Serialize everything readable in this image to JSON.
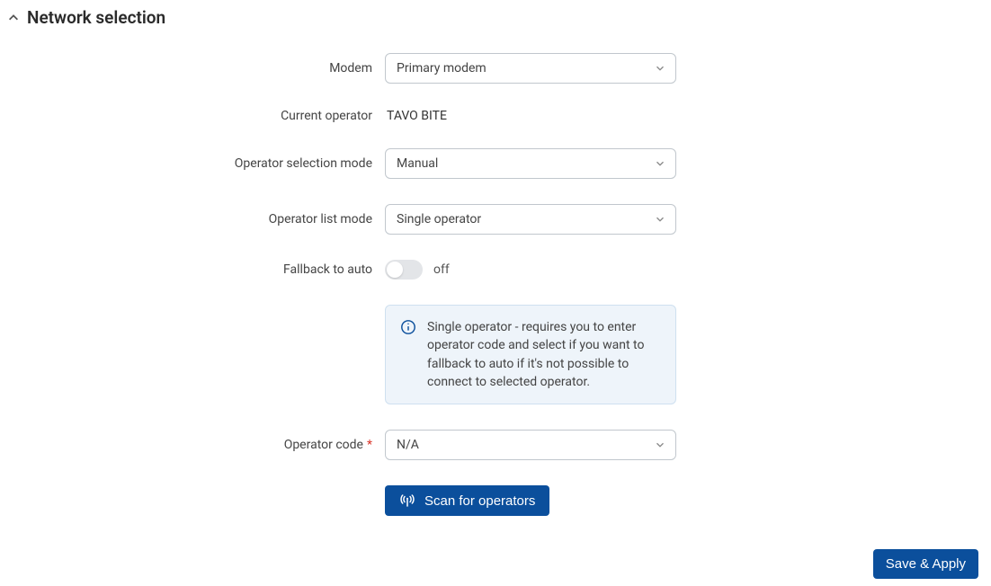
{
  "section": {
    "title": "Network selection"
  },
  "form": {
    "modem": {
      "label": "Modem",
      "value": "Primary modem"
    },
    "current_operator": {
      "label": "Current operator",
      "value": "TAVO BITE"
    },
    "selection_mode": {
      "label": "Operator selection mode",
      "value": "Manual"
    },
    "list_mode": {
      "label": "Operator list mode",
      "value": "Single operator"
    },
    "fallback": {
      "label": "Fallback to auto",
      "state": "off"
    },
    "info": {
      "text": "Single operator - requires you to enter operator code and select if you want to fallback to auto if it's not possible to connect to selected operator."
    },
    "operator_code": {
      "label": "Operator code",
      "value": "N/A"
    },
    "scan_button": "Scan for operators"
  },
  "save_apply": "Save & Apply"
}
